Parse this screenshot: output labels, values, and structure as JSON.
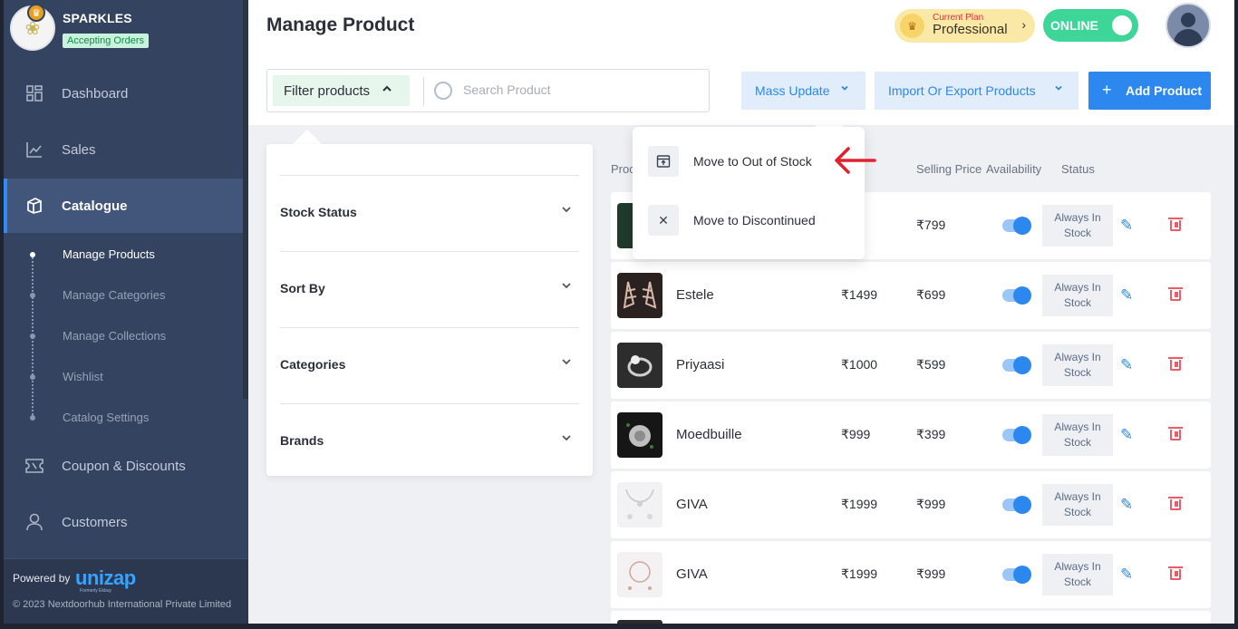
{
  "store": {
    "name": "SPARKLES",
    "status_badge": "Accepting Orders"
  },
  "sidebar": {
    "items": [
      {
        "label": "Dashboard",
        "icon": "dashboard-icon"
      },
      {
        "label": "Sales",
        "icon": "chart-icon"
      },
      {
        "label": "Catalogue",
        "icon": "catalogue-icon"
      },
      {
        "label": "Coupon & Discounts",
        "icon": "coupon-icon"
      },
      {
        "label": "Customers",
        "icon": "user-icon"
      }
    ],
    "subitems": [
      "Manage Products",
      "Manage Categories",
      "Manage Collections",
      "Wishlist",
      "Catalog Settings"
    ],
    "active_item": "Catalogue",
    "active_subitem": "Manage Products",
    "powered_by": "Powered by",
    "brand": "unizap",
    "brand_sub": "Formerly Ekbuy",
    "copyright": "© 2023 Nextdoorhub International Private Limited"
  },
  "header": {
    "title": "Manage Product",
    "plan_label": "Current Plan",
    "plan_name": "Professional",
    "plan_chevron": "›",
    "online_label": "ONLINE"
  },
  "toolbar": {
    "filter_label": "Filter products",
    "filter_chevron": "⌃",
    "search_placeholder": "Search Product",
    "mass_update": "Mass Update",
    "import_export": "Import Or Export Products",
    "add_icon": "+",
    "add_product": "Add Product",
    "chevron": "⌄"
  },
  "filter_panel": {
    "sections": [
      "Stock Status",
      "Sort By",
      "Categories",
      "Brands"
    ],
    "chevron": "⌄"
  },
  "table": {
    "headers": {
      "product": "Prod",
      "selling_price": "Selling Price",
      "availability": "Availability",
      "status": "Status"
    },
    "rows": [
      {
        "name": "",
        "mrp": "00",
        "price": "₹799",
        "status": "Always In Stock"
      },
      {
        "name": "Estele",
        "mrp": "₹1499",
        "price": "₹699",
        "status": "Always In Stock"
      },
      {
        "name": "Priyaasi",
        "mrp": "₹1000",
        "price": "₹599",
        "status": "Always In Stock"
      },
      {
        "name": "Moedbuille",
        "mrp": "₹999",
        "price": "₹399",
        "status": "Always In Stock"
      },
      {
        "name": "GIVA",
        "mrp": "₹1999",
        "price": "₹999",
        "status": "Always In Stock"
      },
      {
        "name": "GIVA",
        "mrp": "₹1999",
        "price": "₹999",
        "status": "Always In Stock"
      }
    ],
    "edit_icon": "✎"
  },
  "mass_update_menu": {
    "items": [
      {
        "label": "Move to Out of Stock",
        "icon": "archive-icon",
        "glyph": "⊡"
      },
      {
        "label": "Move to Discontinued",
        "icon": "close-icon",
        "glyph": "✕"
      }
    ]
  },
  "colors": {
    "accent": "#2c88ef",
    "sidebar": "#34435f",
    "online": "#3ed598",
    "annotation": "#e3212d"
  }
}
